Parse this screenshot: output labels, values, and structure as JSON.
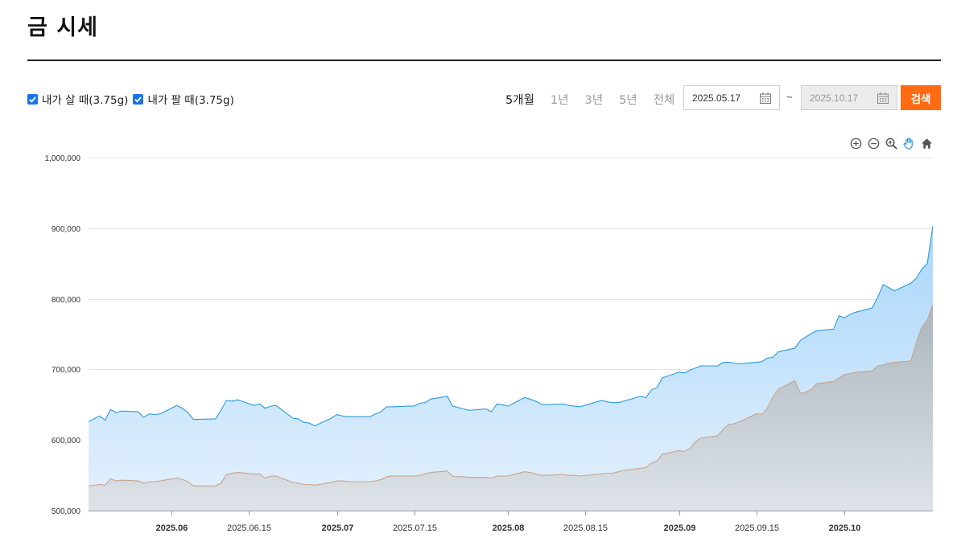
{
  "page": {
    "title": "금 시세"
  },
  "toggles": [
    {
      "label": "내가 살 때(3.75g)",
      "checked": true
    },
    {
      "label": "내가 팔 때(3.75g)",
      "checked": true
    }
  ],
  "period_tabs": [
    {
      "label": "5개월",
      "active": true
    },
    {
      "label": "1년",
      "active": false
    },
    {
      "label": "3년",
      "active": false
    },
    {
      "label": "5년",
      "active": false
    },
    {
      "label": "전체",
      "active": false
    }
  ],
  "date_range": {
    "start": "2025.05.17",
    "separator": "~",
    "end": "2025.10.17"
  },
  "search_label": "검색",
  "toolbar_icons": [
    "zoom-in-icon",
    "zoom-out-icon",
    "magnifier-icon",
    "pan-hand-icon",
    "home-icon"
  ],
  "colors": {
    "accent": "#ff6a13",
    "buy_line": "#2b9ae0",
    "buy_fill_top": "#a9d6fb",
    "buy_fill_bottom": "#e4f1fc",
    "sell_line": "#c9a38a",
    "sell_fill_top": "#aab5bd",
    "sell_fill_bottom": "#dde3e8"
  },
  "chart_data": {
    "type": "area",
    "xlim": [
      "2025-05-17",
      "2025-10-17"
    ],
    "ylim": [
      500000,
      1000000
    ],
    "yticks": [
      500000,
      600000,
      700000,
      800000,
      900000,
      1000000
    ],
    "ytick_labels": [
      "500,000",
      "600,000",
      "700,000",
      "800,000",
      "900,000",
      "1,000,000"
    ],
    "xticks": [
      {
        "date": "2025-06-01",
        "label": "2025.06",
        "major": true
      },
      {
        "date": "2025-06-15",
        "label": "2025.06.15",
        "major": false
      },
      {
        "date": "2025-07-01",
        "label": "2025.07",
        "major": true
      },
      {
        "date": "2025-07-15",
        "label": "2025.07.15",
        "major": false
      },
      {
        "date": "2025-08-01",
        "label": "2025.08",
        "major": true
      },
      {
        "date": "2025-08-15",
        "label": "2025.08.15",
        "major": false
      },
      {
        "date": "2025-09-01",
        "label": "2025.09",
        "major": true
      },
      {
        "date": "2025-09-15",
        "label": "2025.09.15",
        "major": false
      },
      {
        "date": "2025-10-01",
        "label": "2025.10",
        "major": true
      }
    ],
    "grid": true,
    "series": [
      {
        "name": "내가 살 때(3.75g)",
        "x": [
          "2025-05-17",
          "2025-05-19",
          "2025-05-20",
          "2025-05-21",
          "2025-05-22",
          "2025-05-23",
          "2025-05-26",
          "2025-05-27",
          "2025-05-28",
          "2025-05-29",
          "2025-05-30",
          "2025-06-02",
          "2025-06-03",
          "2025-06-04",
          "2025-06-05",
          "2025-06-09",
          "2025-06-10",
          "2025-06-11",
          "2025-06-12",
          "2025-06-13",
          "2025-06-16",
          "2025-06-17",
          "2025-06-18",
          "2025-06-19",
          "2025-06-20",
          "2025-06-23",
          "2025-06-24",
          "2025-06-25",
          "2025-06-26",
          "2025-06-27",
          "2025-06-30",
          "2025-07-01",
          "2025-07-02",
          "2025-07-03",
          "2025-07-07",
          "2025-07-08",
          "2025-07-09",
          "2025-07-10",
          "2025-07-11",
          "2025-07-14",
          "2025-07-15",
          "2025-07-16",
          "2025-07-17",
          "2025-07-18",
          "2025-07-21",
          "2025-07-22",
          "2025-07-23",
          "2025-07-24",
          "2025-07-25",
          "2025-07-28",
          "2025-07-29",
          "2025-07-30",
          "2025-07-31",
          "2025-08-01",
          "2025-08-04",
          "2025-08-05",
          "2025-08-06",
          "2025-08-07",
          "2025-08-08",
          "2025-08-11",
          "2025-08-12",
          "2025-08-13",
          "2025-08-14",
          "2025-08-18",
          "2025-08-19",
          "2025-08-20",
          "2025-08-21",
          "2025-08-22",
          "2025-08-25",
          "2025-08-26",
          "2025-08-27",
          "2025-08-28",
          "2025-08-29",
          "2025-09-01",
          "2025-09-02",
          "2025-09-03",
          "2025-09-04",
          "2025-09-05",
          "2025-09-08",
          "2025-09-09",
          "2025-09-10",
          "2025-09-11",
          "2025-09-12",
          "2025-09-15",
          "2025-09-16",
          "2025-09-17",
          "2025-09-18",
          "2025-09-19",
          "2025-09-22",
          "2025-09-23",
          "2025-09-24",
          "2025-09-25",
          "2025-09-26",
          "2025-09-29",
          "2025-09-30",
          "2025-10-01",
          "2025-10-02",
          "2025-10-03",
          "2025-10-06",
          "2025-10-07",
          "2025-10-08",
          "2025-10-09",
          "2025-10-10",
          "2025-10-13",
          "2025-10-14",
          "2025-10-15",
          "2025-10-16",
          "2025-10-17"
        ],
        "values": [
          626000,
          634000,
          628000,
          643000,
          639000,
          641000,
          640000,
          632000,
          637000,
          636000,
          637000,
          649000,
          645000,
          639000,
          629000,
          630000,
          642000,
          656000,
          655000,
          657000,
          649000,
          651000,
          645000,
          648000,
          649000,
          631000,
          630000,
          625000,
          624000,
          620000,
          631000,
          636000,
          634000,
          633000,
          633000,
          637000,
          640000,
          647000,
          647000,
          648000,
          648000,
          652000,
          653000,
          658000,
          662000,
          648000,
          646000,
          644000,
          642000,
          644000,
          640000,
          651000,
          650000,
          648000,
          660000,
          658000,
          655000,
          651000,
          650000,
          651000,
          649000,
          648000,
          647000,
          656000,
          654000,
          653000,
          653000,
          655000,
          662000,
          660000,
          671000,
          674000,
          688000,
          696000,
          695000,
          699000,
          702000,
          705000,
          705000,
          710000,
          710000,
          709000,
          708000,
          710000,
          711000,
          716000,
          717000,
          725000,
          730000,
          741000,
          746000,
          751000,
          755000,
          757000,
          776000,
          773000,
          778000,
          781000,
          787000,
          802000,
          820000,
          816000,
          811000,
          822000,
          829000,
          842000,
          850000,
          903000
        ]
      },
      {
        "name": "내가 팔 때(3.75g)",
        "x": [
          "2025-05-17",
          "2025-05-19",
          "2025-05-20",
          "2025-05-21",
          "2025-05-22",
          "2025-05-23",
          "2025-05-26",
          "2025-05-27",
          "2025-05-28",
          "2025-05-29",
          "2025-05-30",
          "2025-06-02",
          "2025-06-03",
          "2025-06-04",
          "2025-06-05",
          "2025-06-09",
          "2025-06-10",
          "2025-06-11",
          "2025-06-12",
          "2025-06-13",
          "2025-06-16",
          "2025-06-17",
          "2025-06-18",
          "2025-06-19",
          "2025-06-20",
          "2025-06-23",
          "2025-06-24",
          "2025-06-25",
          "2025-06-26",
          "2025-06-27",
          "2025-06-30",
          "2025-07-01",
          "2025-07-02",
          "2025-07-03",
          "2025-07-07",
          "2025-07-08",
          "2025-07-09",
          "2025-07-10",
          "2025-07-11",
          "2025-07-14",
          "2025-07-15",
          "2025-07-16",
          "2025-07-17",
          "2025-07-18",
          "2025-07-21",
          "2025-07-22",
          "2025-07-23",
          "2025-07-24",
          "2025-07-25",
          "2025-07-28",
          "2025-07-29",
          "2025-07-30",
          "2025-07-31",
          "2025-08-01",
          "2025-08-04",
          "2025-08-05",
          "2025-08-06",
          "2025-08-07",
          "2025-08-08",
          "2025-08-11",
          "2025-08-12",
          "2025-08-13",
          "2025-08-14",
          "2025-08-18",
          "2025-08-19",
          "2025-08-20",
          "2025-08-21",
          "2025-08-22",
          "2025-08-25",
          "2025-08-26",
          "2025-08-27",
          "2025-08-28",
          "2025-08-29",
          "2025-09-01",
          "2025-09-02",
          "2025-09-03",
          "2025-09-04",
          "2025-09-05",
          "2025-09-08",
          "2025-09-09",
          "2025-09-10",
          "2025-09-11",
          "2025-09-12",
          "2025-09-15",
          "2025-09-16",
          "2025-09-17",
          "2025-09-18",
          "2025-09-19",
          "2025-09-22",
          "2025-09-23",
          "2025-09-24",
          "2025-09-25",
          "2025-09-26",
          "2025-09-29",
          "2025-09-30",
          "2025-10-01",
          "2025-10-02",
          "2025-10-03",
          "2025-10-06",
          "2025-10-07",
          "2025-10-08",
          "2025-10-09",
          "2025-10-10",
          "2025-10-13",
          "2025-10-14",
          "2025-10-15",
          "2025-10-16",
          "2025-10-17"
        ],
        "values": [
          535000,
          537000,
          536000,
          545000,
          542000,
          543000,
          542000,
          539000,
          541000,
          541000,
          542000,
          546000,
          544000,
          541000,
          535000,
          535000,
          539000,
          551000,
          553000,
          554000,
          552000,
          552000,
          546000,
          549000,
          549000,
          540000,
          539000,
          537000,
          537000,
          536000,
          540000,
          542000,
          542000,
          541000,
          541000,
          542000,
          544000,
          548000,
          549000,
          549000,
          549000,
          550000,
          552000,
          554000,
          556000,
          549000,
          548000,
          548000,
          547000,
          547000,
          546000,
          549000,
          549000,
          549000,
          555000,
          554000,
          552000,
          550000,
          550000,
          551000,
          550000,
          550000,
          549000,
          552000,
          553000,
          553000,
          555000,
          557000,
          560000,
          561000,
          567000,
          570000,
          580000,
          585000,
          584000,
          588000,
          598000,
          603000,
          606000,
          615000,
          622000,
          623000,
          626000,
          637000,
          636000,
          645000,
          661000,
          672000,
          684000,
          666000,
          668000,
          672000,
          680000,
          683000,
          688000,
          693000,
          694000,
          696000,
          698000,
          705000,
          706000,
          709000,
          710000,
          712000,
          738000,
          760000,
          770000,
          792000
        ]
      }
    ]
  }
}
